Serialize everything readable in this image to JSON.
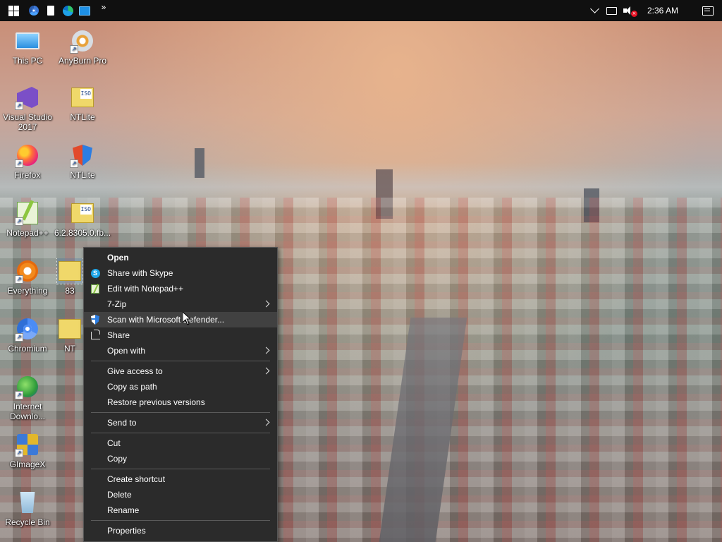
{
  "taskbar": {
    "icons": [
      "windows-start-icon",
      "chrome-icon",
      "document-icon",
      "edge-icon",
      "monitor-icon"
    ],
    "overflow_label": "»",
    "clock": "2:36 AM"
  },
  "desktop": {
    "icons": [
      {
        "label": "This PC",
        "icon": "computer-icon"
      },
      {
        "label": "AnyBurn Pro",
        "icon": "disc-icon"
      },
      {
        "label": "Visual Studio 2017",
        "icon": "visual-studio-icon"
      },
      {
        "label": "NTLite",
        "icon": "iso-file-icon"
      },
      {
        "label": "Firefox",
        "icon": "firefox-icon"
      },
      {
        "label": "NTLite",
        "icon": "shield-icon"
      },
      {
        "label": "Notepad++",
        "icon": "notepad-plus-plus-icon"
      },
      {
        "label": "6.2.8305.0.fb...",
        "icon": "iso-file-icon"
      },
      {
        "label": "Everything",
        "icon": "everything-icon"
      },
      {
        "label": "83",
        "icon": "folder-icon"
      },
      {
        "label": "Chromium",
        "icon": "chromium-icon"
      },
      {
        "label": "NT",
        "icon": "folder-icon"
      },
      {
        "label": "Internet Downlo...",
        "icon": "internet-download-manager-icon"
      },
      {
        "label": "GImageX",
        "icon": "gimagex-icon"
      },
      {
        "label": "Recycle Bin",
        "icon": "recycle-bin-icon"
      }
    ]
  },
  "context_menu": {
    "open": "Open",
    "share_with_skype": "Share with Skype",
    "edit_with_notepadpp": "Edit with Notepad++",
    "seven_zip": "7-Zip",
    "scan_with_defender": "Scan with Microsoft Defender...",
    "share": "Share",
    "open_with": "Open with",
    "give_access_to": "Give access to",
    "copy_as_path": "Copy as path",
    "restore_previous_versions": "Restore previous versions",
    "send_to": "Send to",
    "cut": "Cut",
    "copy": "Copy",
    "create_shortcut": "Create shortcut",
    "delete": "Delete",
    "rename": "Rename",
    "properties": "Properties"
  }
}
